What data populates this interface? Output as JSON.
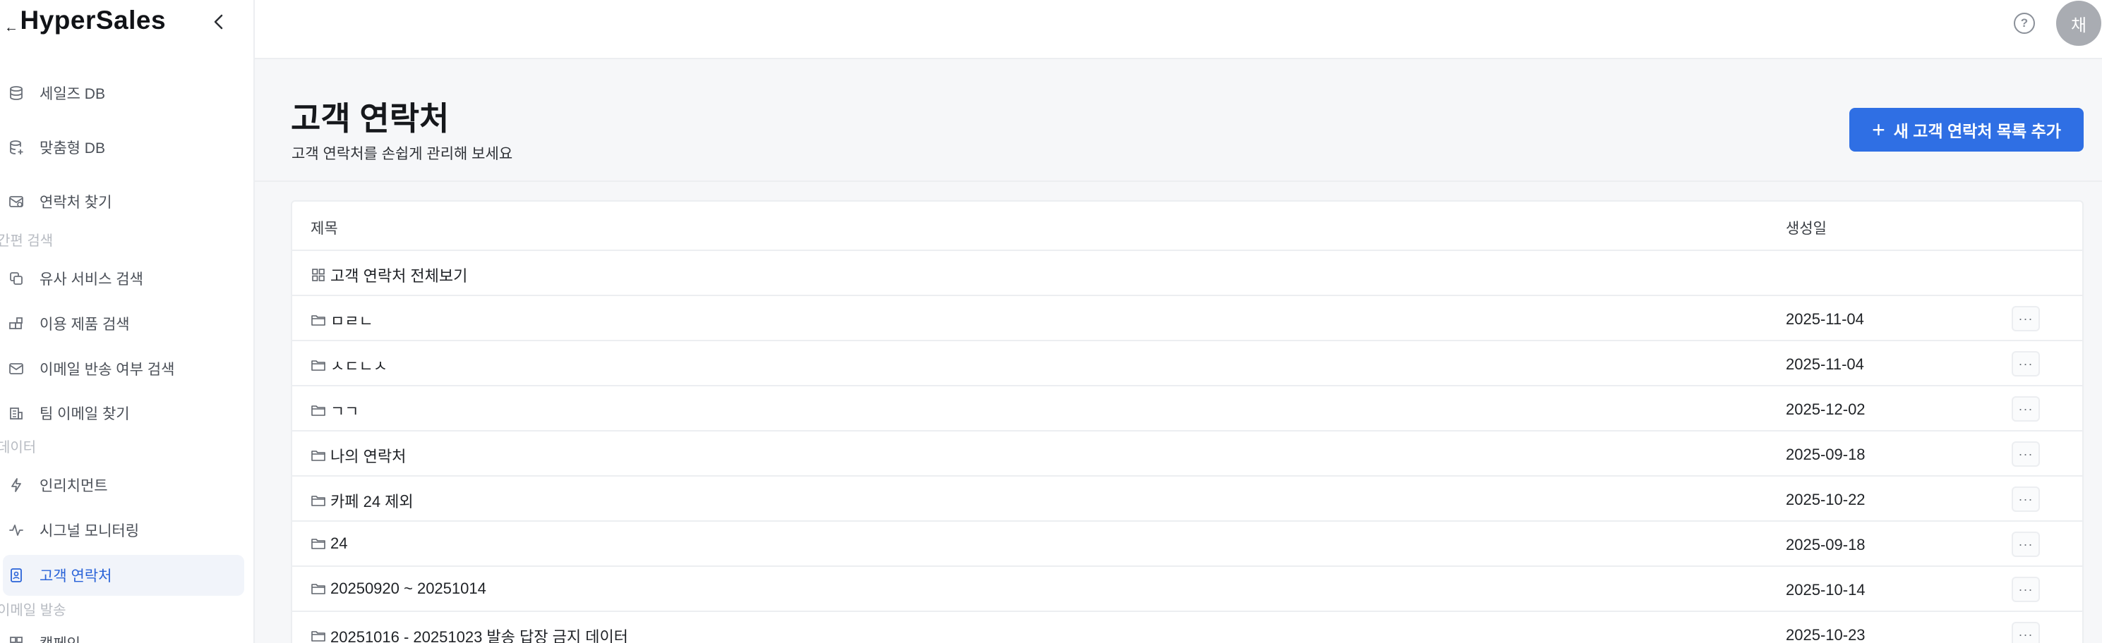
{
  "brand": {
    "name": "HyperSales"
  },
  "sidebar": {
    "items": [
      {
        "label": "세일즈 DB",
        "icon": "database-icon"
      },
      {
        "label": "맞춤형 DB",
        "icon": "database-plus-icon"
      },
      {
        "label": "연락처 찾기",
        "icon": "mail-search-icon"
      }
    ],
    "sections": [
      {
        "label": "간편 검색",
        "items": [
          {
            "label": "유사 서비스 검색",
            "icon": "copy-icon"
          },
          {
            "label": "이용 제품 검색",
            "icon": "blocks-icon"
          },
          {
            "label": "이메일 반송 여부 검색",
            "icon": "mail-icon"
          },
          {
            "label": "팀 이메일 찾기",
            "icon": "building-icon"
          }
        ]
      },
      {
        "label": "데이터",
        "items": [
          {
            "label": "인리치먼트",
            "icon": "bolt-icon"
          },
          {
            "label": "시그널 모니터링",
            "icon": "activity-icon"
          },
          {
            "label": "고객 연락처",
            "icon": "contact-book-icon",
            "active": true
          }
        ]
      },
      {
        "label": "이메일 발송",
        "items": [
          {
            "label": "캠페인",
            "icon": "grid-icon"
          }
        ]
      }
    ]
  },
  "header": {
    "help_icon": "?",
    "avatar_initial": "채"
  },
  "page": {
    "title": "고객 연락처",
    "subtitle": "고객 연락처를 손쉽게 관리해 보세요",
    "add_button": {
      "icon": "+",
      "label": "새 고객 연락처 목록 추가"
    }
  },
  "table": {
    "columns": {
      "title": "제목",
      "created": "생성일"
    },
    "rows": [
      {
        "title": "고객 연락처 전체보기",
        "date": "",
        "icon": "grid-icon",
        "more": false
      },
      {
        "title": "ㅁㄹㄴ",
        "date": "2025-11-04",
        "icon": "folder-icon",
        "more": true
      },
      {
        "title": "ㅅㄷㄴㅅ",
        "date": "2025-11-04",
        "icon": "folder-icon",
        "more": true
      },
      {
        "title": "ㄱㄱ",
        "date": "2025-12-02",
        "icon": "folder-icon",
        "more": true
      },
      {
        "title": "나의 연락처",
        "date": "2025-09-18",
        "icon": "folder-icon",
        "more": true
      },
      {
        "title": "카페 24 제외",
        "date": "2025-10-22",
        "icon": "folder-icon",
        "more": true
      },
      {
        "title": "24",
        "date": "2025-09-18",
        "icon": "folder-icon",
        "more": true
      },
      {
        "title": "20250920 ~ 20251014",
        "date": "2025-10-14",
        "icon": "folder-icon",
        "more": true
      },
      {
        "title": "20251016 - 20251023 발송 답장 금지 데이터",
        "date": "2025-10-23",
        "icon": "folder-icon",
        "more": true
      }
    ],
    "more_label": "···"
  }
}
